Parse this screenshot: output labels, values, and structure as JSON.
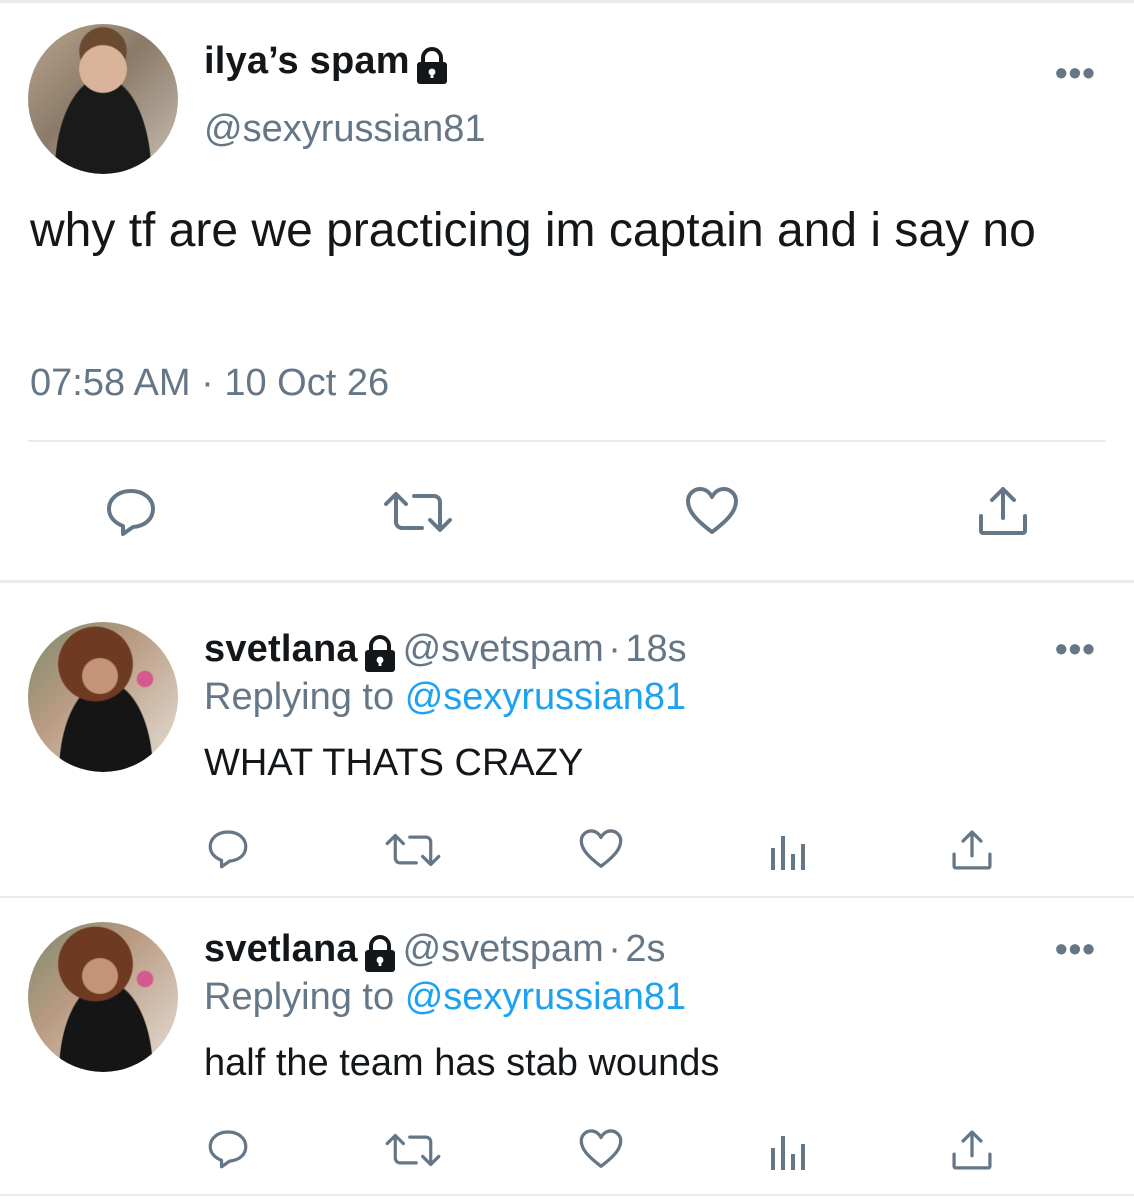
{
  "main_tweet": {
    "display_name": "ilya’s spam",
    "handle": "@sexyrussian81",
    "text": "why tf are we practicing im captain and i say no",
    "time": "07:58 AM",
    "separator": "·",
    "date": "10 Oct 26",
    "more_label": "•••"
  },
  "replies": [
    {
      "display_name": "svetlana",
      "handle": "@svetspam",
      "separator": "·",
      "age": "18s",
      "replying_prefix": "Replying to",
      "replying_handle": "@sexyrussian81",
      "text": "WHAT THATS CRAZY",
      "more_label": "•••"
    },
    {
      "display_name": "svetlana",
      "handle": "@svetspam",
      "separator": "·",
      "age": "2s",
      "replying_prefix": "Replying to",
      "replying_handle": "@sexyrussian81",
      "text": "half the team has stab wounds",
      "more_label": "•••"
    }
  ],
  "icons": {
    "reply": "reply-icon",
    "retweet": "retweet-icon",
    "like": "heart-icon",
    "analytics": "analytics-icon",
    "share": "share-icon",
    "lock": "lock-icon"
  },
  "colors": {
    "text": "#14171a",
    "muted": "#657786",
    "link": "#1da1f2",
    "divider": "#e6ecf0"
  }
}
